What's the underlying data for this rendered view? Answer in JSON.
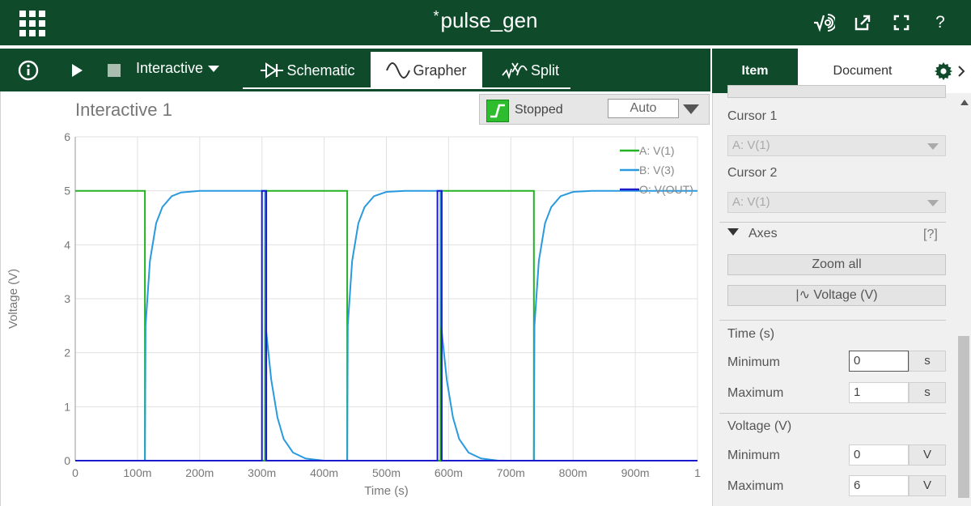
{
  "app": {
    "doc_modified_mark": "*",
    "doc_title": "pulse_gen"
  },
  "toolbar": {
    "mode_label": "Interactive",
    "tabs": [
      {
        "label": "Schematic",
        "icon": "diode-icon"
      },
      {
        "label": "Grapher",
        "icon": "sine-wave-icon",
        "active": true
      },
      {
        "label": "Split",
        "icon": "split-icon"
      }
    ]
  },
  "panel": {
    "tabs": {
      "item": "Item",
      "document": "Document"
    },
    "cursor1_label": "Cursor 1",
    "cursor1_value": "A: V(1)",
    "cursor2_label": "Cursor 2",
    "cursor2_value": "A: V(1)",
    "axes_label": "Axes",
    "axes_help": "[?]",
    "zoom_all": "Zoom all",
    "voltage_axis_button": "|∿  Voltage (V)",
    "time_section": "Time (s)",
    "time_min_label": "Minimum",
    "time_min_value": "0",
    "time_min_unit": "s",
    "time_max_label": "Maximum",
    "time_max_value": "1",
    "time_max_unit": "s",
    "voltage_section": "Voltage (V)",
    "volt_min_label": "Minimum",
    "volt_min_value": "0",
    "volt_min_unit": "V",
    "volt_max_label": "Maximum",
    "volt_max_value": "6",
    "volt_max_unit": "V"
  },
  "status": {
    "state": "Stopped",
    "mode": "Auto"
  },
  "colors": {
    "brand": "#0f4a2a",
    "series_a": "#22b322",
    "series_b": "#2a9ae0",
    "series_o": "#1a1acc"
  },
  "chart_data": {
    "type": "line",
    "title": "Interactive 1",
    "xlabel": "Time (s)",
    "ylabel": "Voltage (V)",
    "xlim": [
      0,
      1
    ],
    "ylim": [
      0,
      6
    ],
    "grid": true,
    "legend_position": "top-right",
    "x_tick_labels": [
      "0",
      "100m",
      "200m",
      "300m",
      "400m",
      "500m",
      "600m",
      "700m",
      "800m",
      "900m",
      "1"
    ],
    "y_tick_labels": [
      "0",
      "1",
      "2",
      "3",
      "4",
      "5",
      "6"
    ],
    "series": [
      {
        "name": "A: V(1)",
        "color": "#22b322",
        "points": [
          [
            0,
            5
          ],
          [
            0.112,
            5
          ],
          [
            0.112,
            0
          ],
          [
            0.305,
            0
          ],
          [
            0.305,
            5
          ],
          [
            0.437,
            5
          ],
          [
            0.437,
            0
          ],
          [
            0.587,
            0
          ],
          [
            0.587,
            5
          ],
          [
            0.737,
            5
          ],
          [
            0.737,
            0
          ],
          [
            1,
            0
          ]
        ]
      },
      {
        "name": "B: V(3)",
        "color": "#2a9ae0",
        "points": [
          [
            0,
            0
          ],
          [
            0.112,
            0
          ],
          [
            0.113,
            2.5
          ],
          [
            0.12,
            3.7
          ],
          [
            0.13,
            4.4
          ],
          [
            0.14,
            4.7
          ],
          [
            0.155,
            4.9
          ],
          [
            0.17,
            4.97
          ],
          [
            0.2,
            5
          ],
          [
            0.305,
            5
          ],
          [
            0.306,
            2.5
          ],
          [
            0.315,
            1.5
          ],
          [
            0.325,
            0.8
          ],
          [
            0.335,
            0.4
          ],
          [
            0.35,
            0.15
          ],
          [
            0.37,
            0.04
          ],
          [
            0.4,
            0
          ],
          [
            0.437,
            0
          ],
          [
            0.438,
            2.5
          ],
          [
            0.445,
            3.7
          ],
          [
            0.455,
            4.4
          ],
          [
            0.465,
            4.7
          ],
          [
            0.48,
            4.9
          ],
          [
            0.5,
            4.98
          ],
          [
            0.53,
            5
          ],
          [
            0.587,
            5
          ],
          [
            0.588,
            2.5
          ],
          [
            0.597,
            1.5
          ],
          [
            0.607,
            0.8
          ],
          [
            0.617,
            0.4
          ],
          [
            0.632,
            0.15
          ],
          [
            0.652,
            0.04
          ],
          [
            0.68,
            0
          ],
          [
            0.737,
            0
          ],
          [
            0.738,
            2.5
          ],
          [
            0.745,
            3.7
          ],
          [
            0.755,
            4.4
          ],
          [
            0.765,
            4.7
          ],
          [
            0.78,
            4.9
          ],
          [
            0.8,
            4.98
          ],
          [
            0.83,
            5
          ],
          [
            1,
            5
          ]
        ]
      },
      {
        "name": "O: V(OUT)",
        "color": "#1a1acc",
        "points": [
          [
            0,
            0
          ],
          [
            0.3,
            0
          ],
          [
            0.3,
            5
          ],
          [
            0.307,
            5
          ],
          [
            0.307,
            0
          ],
          [
            0.582,
            0
          ],
          [
            0.582,
            5
          ],
          [
            0.589,
            5
          ],
          [
            0.589,
            0
          ],
          [
            1,
            0
          ]
        ]
      }
    ]
  }
}
